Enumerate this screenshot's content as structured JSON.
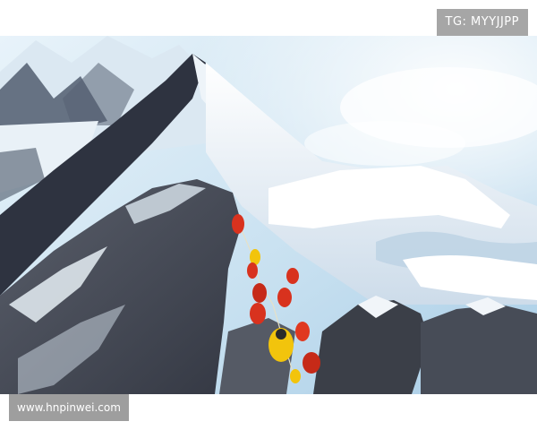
{
  "watermarks": {
    "tag": "TG: MYYJJPP",
    "url": "www.hnpinwei.com"
  },
  "photo": {
    "subject": "summit-ridge-climbers",
    "colors": {
      "sky": "#cfe6f4",
      "snow": "#f4f8fc",
      "shadow_snow": "#b7cde0",
      "rock": "#4a4e57",
      "ridge_dark": "#2e3340",
      "climber_red": "#d8321e",
      "climber_yellow": "#f2c40c"
    }
  }
}
